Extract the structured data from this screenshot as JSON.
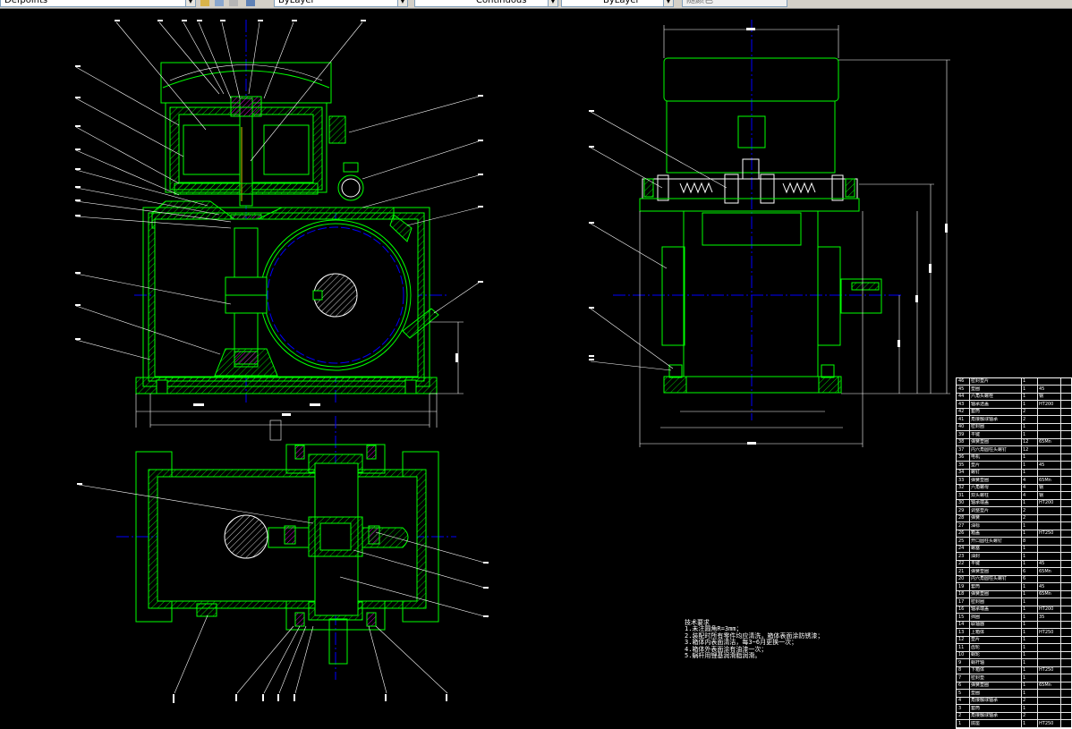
{
  "toolbar": {
    "layer_state": "Defpoints",
    "color": "ByLayer",
    "linetype": "Continuous",
    "lineweight": "ByLayer",
    "plotstyle": "随颜色"
  },
  "technical_notes": {
    "heading": "技术要求",
    "items": [
      "1.未注圆角R=3mm；",
      "2.装配时所有零件均应清洗，箱体表面涂防锈漆；",
      "3.箱体内表面清洁，每3~6月更换一次；",
      "4.箱体外表面涂有油漆一次；",
      "5.蜗杆用锂基润滑脂润滑。"
    ]
  },
  "bom": {
    "rows": [
      [
        "46",
        "密封垫片",
        "1",
        "",
        ""
      ],
      [
        "45",
        "垫圈",
        "1",
        "45",
        ""
      ],
      [
        "44",
        "六角头螺栓",
        "1",
        "钢",
        ""
      ],
      [
        "43",
        "轴承透盖",
        "1",
        "HT200",
        ""
      ],
      [
        "42",
        "套筒",
        "2",
        "",
        ""
      ],
      [
        "41",
        "角接触球轴承",
        "2",
        "",
        ""
      ],
      [
        "40",
        "密封圈",
        "1",
        "",
        ""
      ],
      [
        "39",
        "平键",
        "1",
        "",
        ""
      ],
      [
        "38",
        "弹簧垫圈",
        "12",
        "65Mn",
        ""
      ],
      [
        "37",
        "内六角圆柱头螺钉",
        "12",
        "",
        ""
      ],
      [
        "36",
        "电机",
        "1",
        "",
        ""
      ],
      [
        "35",
        "垫片",
        "1",
        "45",
        ""
      ],
      [
        "34",
        "螺钉",
        "1",
        "",
        ""
      ],
      [
        "33",
        "弹簧垫圈",
        "4",
        "65Mn",
        ""
      ],
      [
        "32",
        "六角螺母",
        "4",
        "钢",
        ""
      ],
      [
        "31",
        "双头螺柱",
        "4",
        "钢",
        ""
      ],
      [
        "30",
        "轴承端盖",
        "1",
        "HT200",
        ""
      ],
      [
        "29",
        "调整垫片",
        "2",
        "",
        ""
      ],
      [
        "28",
        "弹簧",
        "2",
        "",
        ""
      ],
      [
        "27",
        "油标",
        "1",
        "",
        ""
      ],
      [
        "26",
        "箱盖",
        "1",
        "HT250",
        ""
      ],
      [
        "25",
        "开口圆柱头螺钉",
        "8",
        "",
        ""
      ],
      [
        "24",
        "螺塞",
        "1",
        "",
        ""
      ],
      [
        "23",
        "油封",
        "1",
        "",
        ""
      ],
      [
        "22",
        "平键",
        "1",
        "45",
        ""
      ],
      [
        "21",
        "弹簧垫圈",
        "6",
        "65Mn",
        ""
      ],
      [
        "20",
        "内六角圆柱头螺钉",
        "6",
        "",
        ""
      ],
      [
        "19",
        "套筒",
        "1",
        "45",
        ""
      ],
      [
        "18",
        "弹簧垫圈",
        "1",
        "65Mn",
        ""
      ],
      [
        "17",
        "密封圈",
        "1",
        "",
        ""
      ],
      [
        "16",
        "轴承端盖",
        "1",
        "HT200",
        ""
      ],
      [
        "15",
        "挡圈",
        "1",
        "35",
        ""
      ],
      [
        "14",
        "联轴器",
        "1",
        "",
        ""
      ],
      [
        "13",
        "上箱体",
        "1",
        "HT250",
        ""
      ],
      [
        "12",
        "垫片",
        "1",
        "",
        ""
      ],
      [
        "11",
        "齿轮",
        "1",
        "",
        ""
      ],
      [
        "10",
        "蜗轮",
        "1",
        "",
        ""
      ],
      [
        "9",
        "蜗杆轴",
        "1",
        "",
        ""
      ],
      [
        "8",
        "下箱体",
        "1",
        "HT250",
        ""
      ],
      [
        "7",
        "密封垫",
        "1",
        "",
        ""
      ],
      [
        "6",
        "弹簧垫圈",
        "1",
        "65Mn",
        ""
      ],
      [
        "5",
        "垫圈",
        "1",
        "",
        ""
      ],
      [
        "4",
        "角接触球轴承",
        "2",
        "",
        ""
      ],
      [
        "3",
        "套筒",
        "1",
        "",
        ""
      ],
      [
        "2",
        "角接触球轴承",
        "2",
        "",
        ""
      ],
      [
        "1",
        "底座",
        "1",
        "HT250",
        ""
      ]
    ]
  },
  "colors": {
    "background": "#000000",
    "outline": "#00ff00",
    "center_line": "#0000ff",
    "leader": "#ffffff",
    "hatch": "#ff00ff",
    "hidden": "#ffff00"
  }
}
